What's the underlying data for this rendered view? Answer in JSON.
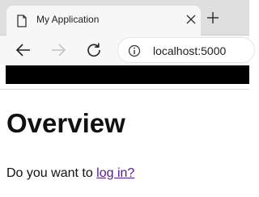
{
  "browser": {
    "tab_title": "My Application",
    "url": "localhost:5000"
  },
  "page": {
    "heading": "Overview",
    "prompt_text": "Do you want to ",
    "login_link": "log in?"
  },
  "icons": {
    "tab": "page-icon",
    "close": "close-icon",
    "new_tab": "plus-icon",
    "back": "arrow-left-icon",
    "forward": "arrow-right-icon",
    "refresh": "refresh-icon",
    "info": "info-icon"
  },
  "colors": {
    "tabstrip": "#dfdfdf",
    "toolbar": "#f7f7f7",
    "navbar": "#000000",
    "link": "#551a8b"
  }
}
